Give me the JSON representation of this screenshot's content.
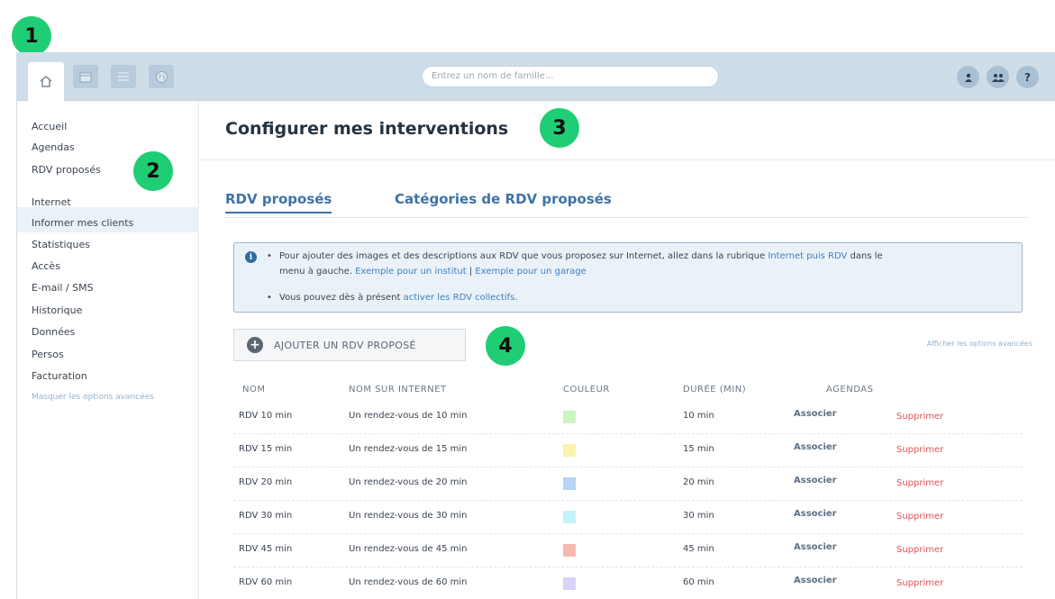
{
  "badges": [
    "1",
    "2",
    "3",
    "4"
  ],
  "topbar": {
    "tabs": [
      {
        "name": "home-icon",
        "glyph": "⌂"
      },
      {
        "name": "calendar-icon",
        "glyph": "▦"
      },
      {
        "name": "list-icon",
        "glyph": "☰"
      },
      {
        "name": "globe-icon",
        "glyph": "◉"
      }
    ],
    "search_placeholder": "Entrez un nom de famille...",
    "buttons": [
      {
        "name": "user-icon",
        "glyph": "●"
      },
      {
        "name": "users-icon",
        "glyph": "●●"
      },
      {
        "name": "help-icon",
        "glyph": "?"
      }
    ]
  },
  "sidebar": {
    "items": [
      "Accueil",
      "Agendas",
      "RDV proposés",
      "Internet",
      "Informer mes clients",
      "Statistiques",
      "Accès",
      "E-mail / SMS",
      "Historique",
      "Données",
      "Persos",
      "Facturation"
    ],
    "hide_link": "Masquer les options avancées"
  },
  "main": {
    "title": "Configurer mes interventions",
    "tabs": [
      "RDV proposés",
      "Catégories de RDV proposés"
    ],
    "info": {
      "line1_a": "Pour ajouter des images et des descriptions aux RDV que vous proposez sur Internet, allez dans la rubrique ",
      "line1_link": "Internet puis RDV",
      "line1_b": " dans le",
      "line2_a": "menu à gauche. ",
      "line2_link1": "Exemple pour un institut",
      "line2_sep": " | ",
      "line2_link2": "Exemple pour un garage",
      "line3_a": "Vous pouvez dès à présent ",
      "line3_link": "activer les RDV collectifs",
      "line3_b": "."
    },
    "add_button": "AJOUTER UN RDV PROPOSÉ",
    "advanced_link": "Afficher les options avancées",
    "table": {
      "headers": [
        "NOM",
        "NOM SUR INTERNET",
        "COULEUR",
        "DURÉE (MIN)",
        "AGENDAS"
      ],
      "rows": [
        {
          "nom": "RDV 10 min",
          "internet": "Un rendez-vous de 10 min",
          "color": "#ccf5c4",
          "duree": "10 min",
          "agendas": "Associer",
          "action": "Supprimer"
        },
        {
          "nom": "RDV 15 min",
          "internet": "Un rendez-vous de 15 min",
          "color": "#fbf2b0",
          "duree": "15 min",
          "agendas": "Associer",
          "action": "Supprimer"
        },
        {
          "nom": "RDV 20 min",
          "internet": "Un rendez-vous de 20 min",
          "color": "#b6d4f5",
          "duree": "20 min",
          "agendas": "Associer",
          "action": "Supprimer"
        },
        {
          "nom": "RDV 30 min",
          "internet": "Un rendez-vous de 30 min",
          "color": "#c4f2f8",
          "duree": "30 min",
          "agendas": "Associer",
          "action": "Supprimer"
        },
        {
          "nom": "RDV 45 min",
          "internet": "Un rendez-vous de 45 min",
          "color": "#f7b9ae",
          "duree": "45 min",
          "agendas": "Associer",
          "action": "Supprimer"
        },
        {
          "nom": "RDV 60 min",
          "internet": "Un rendez-vous de 60 min",
          "color": "#d8d3f7",
          "duree": "60 min",
          "agendas": "Associer",
          "action": "Supprimer"
        }
      ]
    }
  }
}
